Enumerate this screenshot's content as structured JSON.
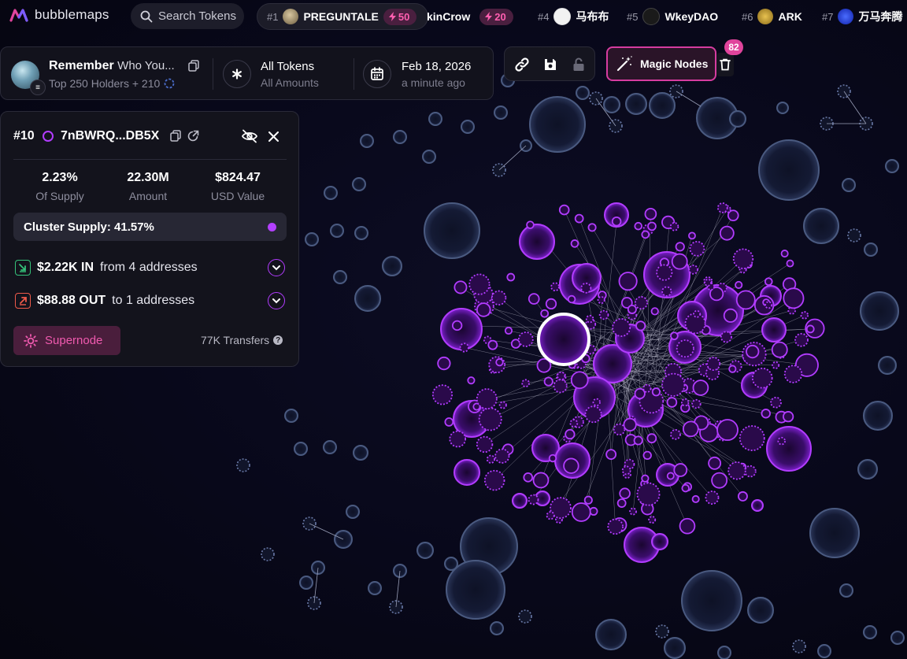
{
  "brand": {
    "name": "bubblemaps"
  },
  "search": {
    "label": "Search Tokens"
  },
  "ticker": [
    {
      "rank": "#1",
      "name": "PREGUNTALE",
      "score": "50",
      "avatar_color": "#8a7a5e"
    },
    {
      "rank": "",
      "name": "kinCrow",
      "score": "20",
      "avatar_color": ""
    },
    {
      "rank": "#4",
      "name": "马布布",
      "score": "",
      "avatar_color": "#f2f2f2"
    },
    {
      "rank": "#5",
      "name": "WkeyDAO",
      "score": "",
      "avatar_color": "#1a1a1a"
    },
    {
      "rank": "#6",
      "name": "ARK",
      "score": "",
      "avatar_color": "#c9a13a"
    },
    {
      "rank": "#7",
      "name": "万马奔腾",
      "score": "",
      "avatar_color": "#2244ee"
    }
  ],
  "token": {
    "name_bold": "Remember",
    "name_rest": "Who You...",
    "subtitle": "Top 250 Holders + 210"
  },
  "filter": {
    "title": "All Tokens",
    "subtitle": "All Amounts"
  },
  "date": {
    "title": "Feb 18, 2026",
    "subtitle": "a minute ago"
  },
  "tools": {
    "magic_label": "Magic Nodes",
    "badge_count": "82"
  },
  "panel": {
    "rank": "#10",
    "address": "7nBWRQ...DB5X",
    "stats": [
      {
        "value": "2.23%",
        "label": "Of Supply"
      },
      {
        "value": "22.30M",
        "label": "Amount"
      },
      {
        "value": "$824.47",
        "label": "USD Value"
      }
    ],
    "cluster_supply": "Cluster Supply: 41.57%",
    "flow_in": {
      "amount": "$2.22K IN",
      "text": "from 4 addresses"
    },
    "flow_out": {
      "amount": "$88.88 OUT",
      "text": "to 1 addresses"
    },
    "supernode_label": "Supernode",
    "transfers": "77K Transfers"
  },
  "colors": {
    "accent_purple": "#b23cff",
    "accent_pink": "#e0449c",
    "bubble_gray": "#3a4a68",
    "in_green": "#35c27a",
    "out_red": "#ef5a4a"
  }
}
